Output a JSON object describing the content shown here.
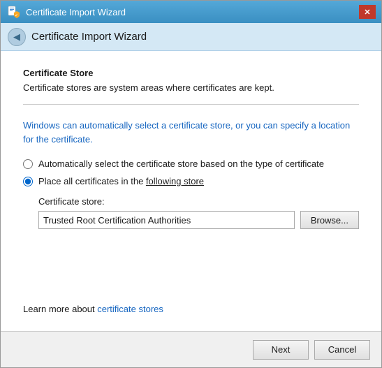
{
  "window": {
    "title": "Certificate Import Wizard",
    "close_label": "✕"
  },
  "nav": {
    "back_icon": "◀",
    "title": "Certificate Import Wizard"
  },
  "content": {
    "section_title": "Certificate Store",
    "section_desc": "Certificate stores are system areas where certificates are kept.",
    "info_text_part1": "Windows can automatically select a certificate store, or you can specify a location for the certificate.",
    "radio1_label": "Automatically select the certificate store based on the type of certificate",
    "radio2_label_part1": "Place all certificates in the ",
    "radio2_label_underline": "following store",
    "cert_store_label": "Certificate store:",
    "cert_store_value": "Trusted Root Certification Authorities",
    "browse_label": "Browse...",
    "learn_more_prefix": "Learn more about ",
    "learn_more_link": "certificate stores"
  },
  "footer": {
    "next_label": "Next",
    "cancel_label": "Cancel"
  }
}
